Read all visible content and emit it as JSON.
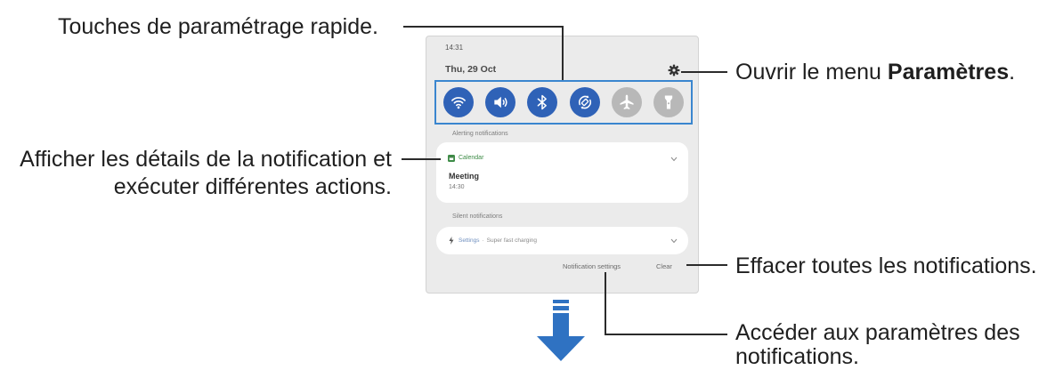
{
  "callouts": {
    "quick_settings": "Touches de paramétrage rapide.",
    "open_settings": {
      "prefix": "Ouvrir le menu ",
      "emphasis": "Paramètres",
      "suffix": "."
    },
    "notification_details": [
      "Afficher les détails de la notification et",
      "exécuter différentes actions."
    ],
    "clear_all": "Effacer toutes les notifications.",
    "notification_settings": [
      "Accéder aux paramètres des",
      "notifications."
    ]
  },
  "panel": {
    "time": "14:31",
    "date": "Thu, 29 Oct",
    "settings_icon": "gear-icon",
    "quick_toggles": [
      {
        "icon": "wifi-icon",
        "on": true
      },
      {
        "icon": "volume-icon",
        "on": true
      },
      {
        "icon": "bluetooth-icon",
        "on": true
      },
      {
        "icon": "auto-rotate-icon",
        "on": true
      },
      {
        "icon": "airplane-icon",
        "on": false
      },
      {
        "icon": "flashlight-icon",
        "on": false
      }
    ],
    "alerting_header": "Alerting notifications",
    "alerting_notification": {
      "app_icon": "calendar-icon",
      "app": "Calendar",
      "title": "Meeting",
      "time": "14:30",
      "expand_icon": "chevron-down-icon"
    },
    "silent_header": "Silent notifications",
    "silent_notification": {
      "icon": "bolt-icon",
      "app": "Settings",
      "separator": "·",
      "text": "Super fast charging",
      "expand_icon": "chevron-down-icon"
    },
    "footer": {
      "notification_settings": "Notification settings",
      "clear": "Clear"
    }
  },
  "swipe_arrow": {
    "icon": "down-arrow-icon"
  },
  "colors": {
    "toggle_on": "#2f62b7",
    "toggle_off": "#b8b8b8",
    "highlight_border": "#3a86cf",
    "callout_line": "#2b2b2b",
    "arrow": "#2f72c2",
    "calendar_green": "#3d8b46"
  }
}
